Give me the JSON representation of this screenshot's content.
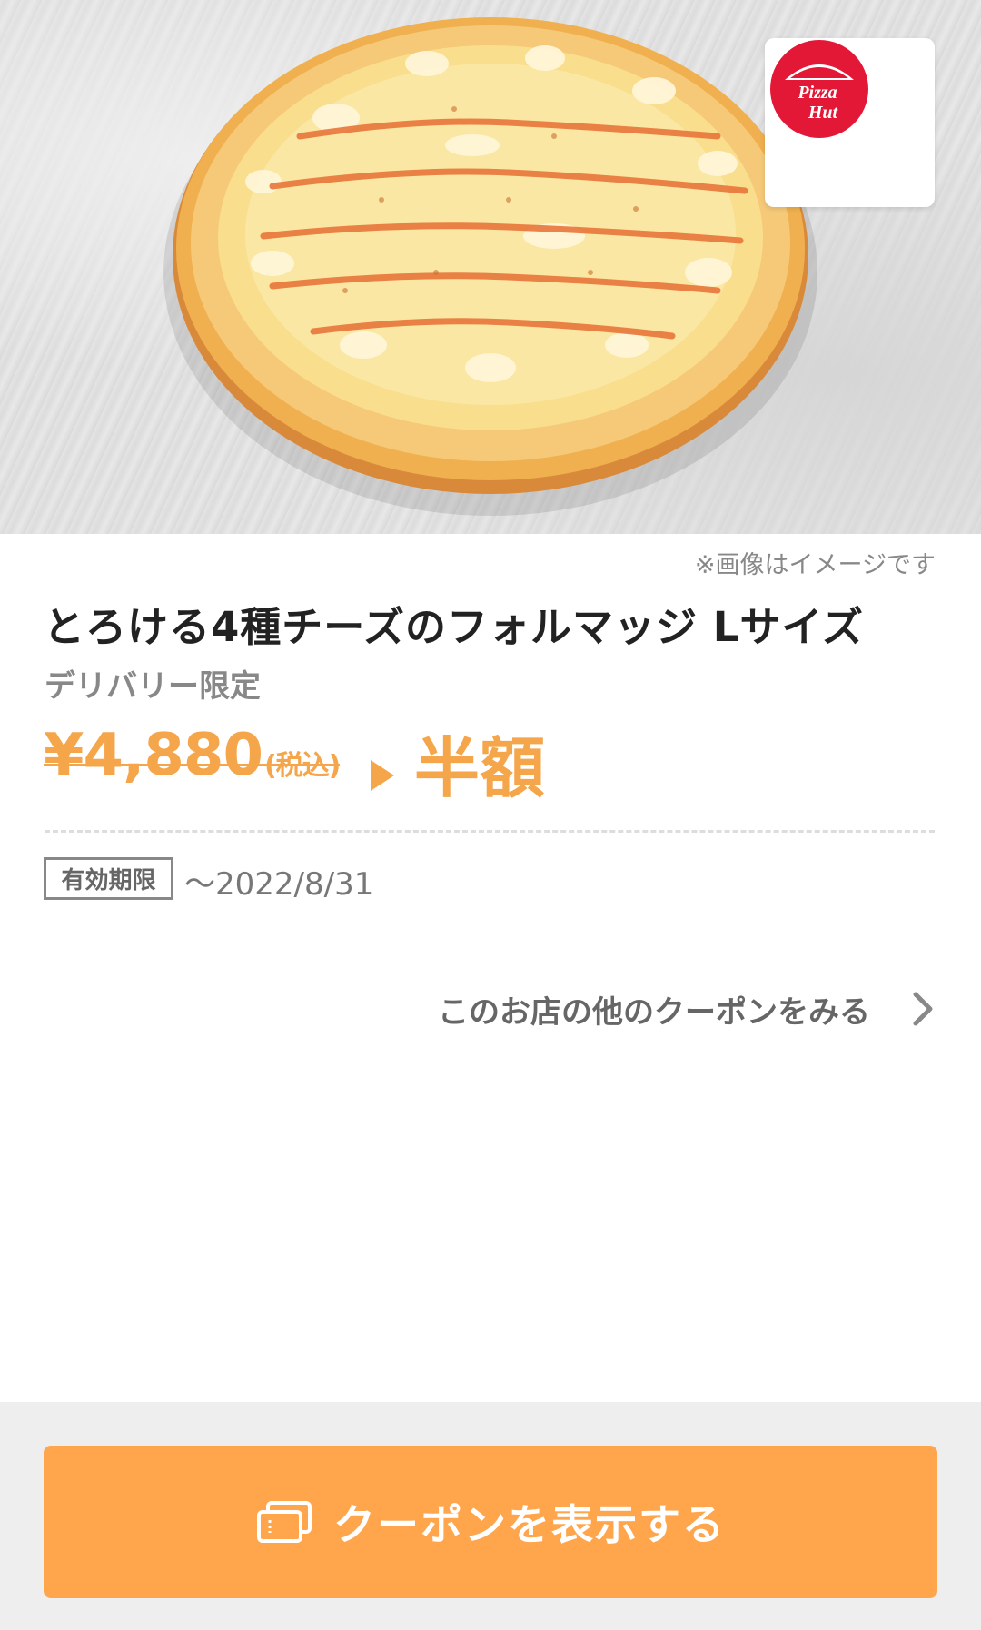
{
  "hero": {
    "image_description_icon": "pizza-photo",
    "brand_logo_text_line1": "Pizza",
    "brand_logo_text_line2": "Hut",
    "brand_color": "#E31837"
  },
  "coupon": {
    "image_note": "※画像はイメージです",
    "title": "とろける4種チーズのフォルマッジ Lサイズ",
    "subtitle": "デリバリー限定",
    "original_price": "¥4,880",
    "tax_note": "(税込)",
    "discount_label": "半額",
    "validity_label": "有効期限",
    "validity_date": "〜2022/8/31"
  },
  "links": {
    "more_coupons_label": "このお店の他のクーポンをみる"
  },
  "footer": {
    "show_coupon_label": "クーポンを表示する"
  },
  "colors": {
    "accent": "#FFA64D",
    "price": "#F5A54A",
    "footer_bg": "#EEEEEE"
  }
}
